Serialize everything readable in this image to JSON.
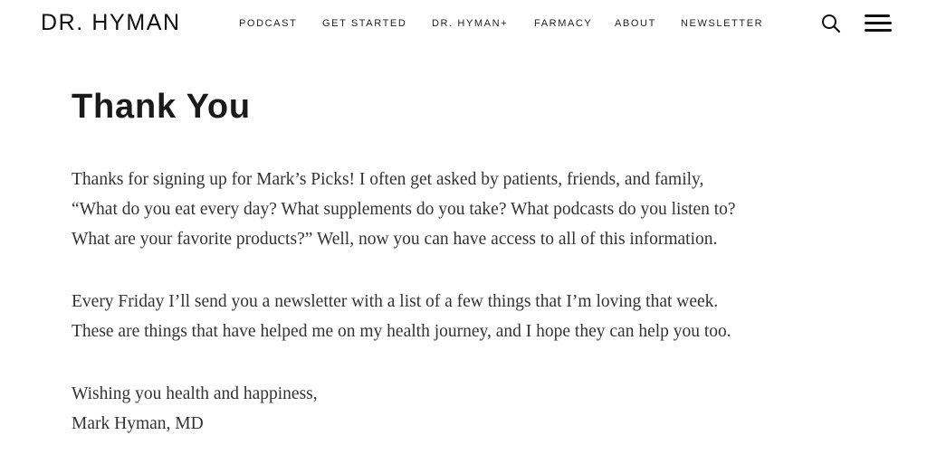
{
  "header": {
    "logo": "DR. HYMAN",
    "nav": [
      {
        "label": "PODCAST"
      },
      {
        "label": "GET STARTED"
      },
      {
        "label": "DR. HYMAN+"
      },
      {
        "label": "FARMACY"
      },
      {
        "label": "ABOUT"
      },
      {
        "label": "NEWSLETTER"
      }
    ],
    "search_icon": "search-icon",
    "menu_icon": "hamburger-menu-icon"
  },
  "main": {
    "title": "Thank You",
    "paragraph1": [
      "Thanks for signing up for Mark’s Picks! I often get asked by patients, friends, and family,",
      "“What do you eat every day? What supplements do you take? What podcasts do you listen to?",
      "What are your favorite products?” Well, now you can have access to all of this information."
    ],
    "paragraph2": [
      "Every Friday I’ll send you a newsletter with a list of a few things that I’m loving that week.",
      "These are things that have helped me on my health journey, and I hope they can help you too."
    ],
    "signoff": [
      "Wishing you health and happiness,",
      "Mark Hyman, MD"
    ]
  },
  "colors": {
    "text": "#333333",
    "heading": "#1a1a1a",
    "background": "#ffffff"
  }
}
